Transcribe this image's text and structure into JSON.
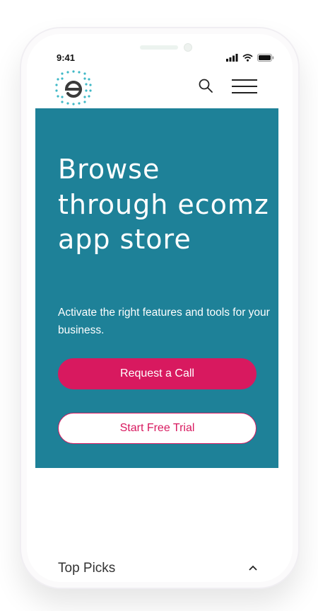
{
  "status_bar": {
    "time": "9:41"
  },
  "header": {
    "logo_icon": "ecomz-logo-icon",
    "search_icon": "search-icon",
    "menu_icon": "hamburger-menu-icon"
  },
  "hero": {
    "title": "Browse through ecomz app store",
    "subtitle": "Activate the right features and tools for your business.",
    "primary_button": "Request a Call",
    "secondary_button": "Start Free Trial"
  },
  "section": {
    "title": "Top Picks"
  },
  "colors": {
    "hero_bg": "#1e8198",
    "accent": "#d8195f",
    "logo_dots": "#3fb8c6"
  }
}
